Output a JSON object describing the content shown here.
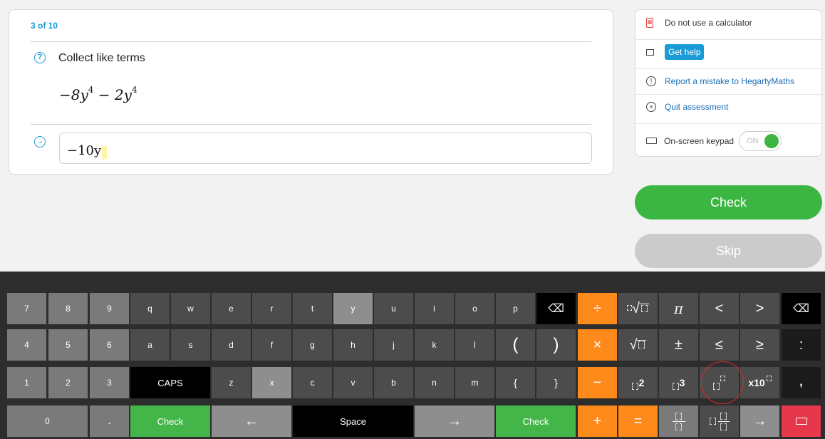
{
  "question": {
    "counter": "3 of 10",
    "help_glyph": "?",
    "instruction": "Collect like terms",
    "expression": {
      "term1": "−8y",
      "exp1": "4",
      "op": "−",
      "term2": "2y",
      "exp2": "4"
    },
    "answer_glyph": "→",
    "answer_value": "−10y"
  },
  "sidebar": {
    "calculator_text": "Do not use a calculator",
    "get_help": "Get help",
    "report": "Report a mistake to HegartyMaths",
    "quit": "Quit assessment",
    "keypad_label": "On-screen keypad",
    "toggle_text": "ON"
  },
  "buttons": {
    "check": "Check",
    "skip": "Skip"
  },
  "keypad": {
    "row1": [
      "7",
      "8",
      "9",
      "q",
      "w",
      "e",
      "r",
      "t",
      "y",
      "u",
      "i",
      "o",
      "p",
      "⌫",
      "÷",
      "",
      "π",
      "<",
      ">",
      "⌫"
    ],
    "row2": [
      "4",
      "5",
      "6",
      "a",
      "s",
      "d",
      "f",
      "g",
      "h",
      "j",
      "k",
      "l",
      "(",
      ")",
      "×",
      "",
      "±",
      "≤",
      "≥",
      ":"
    ],
    "row3": [
      "1",
      "2",
      "3",
      "CAPS",
      "z",
      "x",
      "c",
      "v",
      "b",
      "n",
      "m",
      "{",
      "}",
      "−",
      "2",
      "3",
      "",
      "x10",
      ","
    ],
    "row4": [
      "0",
      ".",
      "Check",
      "←",
      "Space",
      "→",
      "Check",
      "+",
      "=",
      "",
      "",
      "→",
      ""
    ]
  },
  "colors": {
    "accent": "#1a9bd7",
    "green": "#44b649",
    "orange": "#ff8a1c",
    "red": "#e6384a"
  }
}
